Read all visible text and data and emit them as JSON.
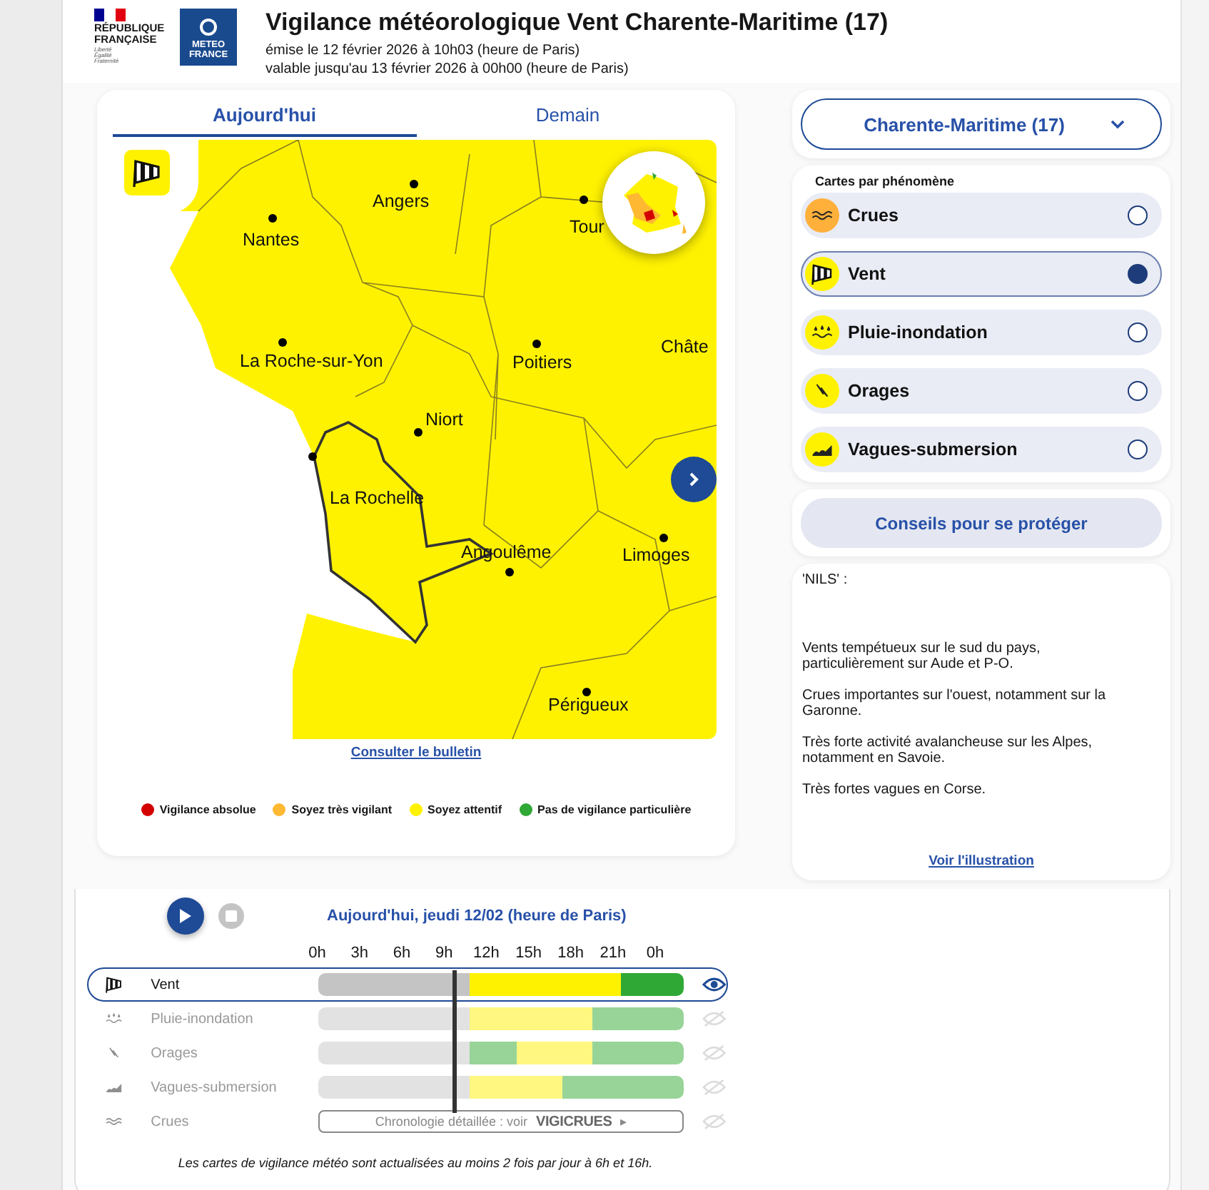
{
  "header": {
    "republic": {
      "name": "RÉPUBLIQUE FRANÇAISE",
      "motto": "Liberté Égalité Fraternité"
    },
    "brand": "METEO FRANCE",
    "title": "Vigilance météorologique Vent Charente-Maritime (17)",
    "issued": "émise le 12 février 2026 à 10h03 (heure de Paris)",
    "valid": "valable jusqu'au 13 février 2026 à 00h00 (heure de Paris)"
  },
  "map_card": {
    "tabs": [
      {
        "label": "Aujourd'hui",
        "selected": true
      },
      {
        "label": "Demain",
        "selected": false
      }
    ],
    "cities": [
      {
        "name": "Angers"
      },
      {
        "name": "Nantes"
      },
      {
        "name": "Tour"
      },
      {
        "name": "La Roche-sur-Yon"
      },
      {
        "name": "Poitiers"
      },
      {
        "name": "Châte"
      },
      {
        "name": "Niort"
      },
      {
        "name": "La Rochelle"
      },
      {
        "name": "Angoulême"
      },
      {
        "name": "Limoges"
      },
      {
        "name": "Périgueux"
      }
    ],
    "bulletin_link": "Consulter le bulletin",
    "legend": [
      {
        "label": "Vigilance absolue",
        "color": "#d40000"
      },
      {
        "label": "Soyez très vigilant",
        "color": "#ffb832"
      },
      {
        "label": "Soyez attentif",
        "color": "#fff200"
      },
      {
        "label": "Pas de vigilance particulière",
        "color": "#30a836"
      }
    ]
  },
  "department_select": {
    "value": "Charente-Maritime (17)"
  },
  "phenomena": {
    "title": "Cartes par phénomène",
    "items": [
      {
        "label": "Crues",
        "kind": "crues",
        "color": "#ffb03b",
        "selected": false
      },
      {
        "label": "Vent",
        "kind": "vent",
        "color": "#fff200",
        "selected": true
      },
      {
        "label": "Pluie-inondation",
        "kind": "pluie",
        "color": "#fff200",
        "selected": false
      },
      {
        "label": "Orages",
        "kind": "orages",
        "color": "#fff200",
        "selected": false
      },
      {
        "label": "Vagues-submersion",
        "kind": "vagues",
        "color": "#fff200",
        "selected": false
      }
    ]
  },
  "advice_button": "Conseils pour se protéger",
  "bulletin": {
    "heading": "'NILS' :",
    "paragraphs": [
      "Vents tempétueux sur le sud du pays, particulièrement sur Aude et P-O.",
      "Crues importantes sur l'ouest, notamment sur la Garonne.",
      "Très forte activité avalancheuse sur les Alpes, notamment en Savoie.",
      "Très fortes vagues en Corse."
    ],
    "link": "Voir l'illustration"
  },
  "timeline": {
    "date": "Aujourd'hui, jeudi 12/02 (heure de Paris)",
    "hours": [
      "0h",
      "3h",
      "6h",
      "9h",
      "12h",
      "15h",
      "18h",
      "21h",
      "0h"
    ],
    "rows": [
      {
        "label": "Vent",
        "kind": "vent",
        "selected": true,
        "segments": [
          {
            "color": "#c4c4c4"
          },
          {
            "color": "#fff200"
          },
          {
            "color": "#30a836"
          }
        ]
      },
      {
        "label": "Pluie-inondation",
        "kind": "pluie",
        "selected": false,
        "segments": [
          {
            "color": "#e2e2e2"
          },
          {
            "color": "#fff780"
          },
          {
            "color": "#98d498"
          }
        ]
      },
      {
        "label": "Orages",
        "kind": "orages",
        "selected": false,
        "segments": [
          {
            "color": "#e2e2e2"
          },
          {
            "color": "#98d498"
          },
          {
            "color": "#fff780"
          },
          {
            "color": "#98d498"
          }
        ]
      },
      {
        "label": "Vagues-submersion",
        "kind": "vagues",
        "selected": false,
        "segments": [
          {
            "color": "#e2e2e2"
          },
          {
            "color": "#fff780"
          },
          {
            "color": "#98d498"
          }
        ]
      },
      {
        "label": "Crues",
        "kind": "crues",
        "selected": false,
        "link": {
          "text": "Chronologie détaillée : voir",
          "brand": "VIGICRUES",
          "arrow": "▸"
        }
      }
    ]
  },
  "footnote": "Les cartes de vigilance météo sont actualisées au moins 2 fois par jour à 6h et 16h."
}
